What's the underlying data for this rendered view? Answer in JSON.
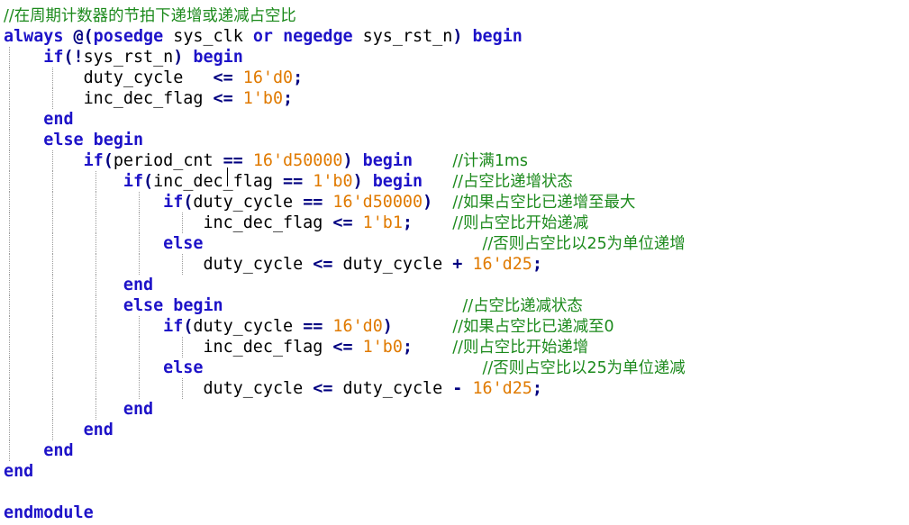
{
  "editor": {
    "language": "Verilog",
    "colors": {
      "keyword": "#1d12c8",
      "identifier": "#000000",
      "number": "#e07a00",
      "operator": "#000080",
      "comment": "#1c8a1c",
      "indent_guide": "#9a9a9a",
      "background": "#ffffff"
    },
    "lines": [
      [
        {
          "t": "cm",
          "v": "//在周期计数器的节拍下递增或递减占空比"
        }
      ],
      [
        {
          "t": "kw",
          "v": "always"
        },
        {
          "t": "id",
          "v": " "
        },
        {
          "t": "op",
          "v": "@("
        },
        {
          "t": "kw",
          "v": "posedge"
        },
        {
          "t": "id",
          "v": " sys_clk "
        },
        {
          "t": "kw",
          "v": "or"
        },
        {
          "t": "id",
          "v": " "
        },
        {
          "t": "kw",
          "v": "negedge"
        },
        {
          "t": "id",
          "v": " sys_rst_n"
        },
        {
          "t": "op",
          "v": ")"
        },
        {
          "t": "id",
          "v": " "
        },
        {
          "t": "kw",
          "v": "begin"
        }
      ],
      [
        {
          "t": "id",
          "v": "    "
        },
        {
          "t": "kw",
          "v": "if"
        },
        {
          "t": "op",
          "v": "(!"
        },
        {
          "t": "id",
          "v": "sys_rst_n"
        },
        {
          "t": "op",
          "v": ")"
        },
        {
          "t": "id",
          "v": " "
        },
        {
          "t": "kw",
          "v": "begin"
        }
      ],
      [
        {
          "t": "id",
          "v": "        duty_cycle   "
        },
        {
          "t": "op",
          "v": "<="
        },
        {
          "t": "id",
          "v": " "
        },
        {
          "t": "num",
          "v": "16'd0"
        },
        {
          "t": "op",
          "v": ";"
        }
      ],
      [
        {
          "t": "id",
          "v": "        inc_dec_flag "
        },
        {
          "t": "op",
          "v": "<="
        },
        {
          "t": "id",
          "v": " "
        },
        {
          "t": "num",
          "v": "1'b0"
        },
        {
          "t": "op",
          "v": ";"
        }
      ],
      [
        {
          "t": "id",
          "v": "    "
        },
        {
          "t": "kw",
          "v": "end"
        }
      ],
      [
        {
          "t": "id",
          "v": "    "
        },
        {
          "t": "kw",
          "v": "else"
        },
        {
          "t": "id",
          "v": " "
        },
        {
          "t": "kw",
          "v": "begin"
        }
      ],
      [
        {
          "t": "id",
          "v": "        "
        },
        {
          "t": "kw",
          "v": "if"
        },
        {
          "t": "op",
          "v": "("
        },
        {
          "t": "id",
          "v": "period_cnt "
        },
        {
          "t": "op",
          "v": "=="
        },
        {
          "t": "id",
          "v": " "
        },
        {
          "t": "num",
          "v": "16'd50000"
        },
        {
          "t": "op",
          "v": ")"
        },
        {
          "t": "id",
          "v": " "
        },
        {
          "t": "kw",
          "v": "begin"
        },
        {
          "t": "id",
          "v": "    "
        },
        {
          "t": "cm",
          "v": "//计满1ms"
        }
      ],
      [
        {
          "t": "id",
          "v": "            "
        },
        {
          "t": "kw",
          "v": "if"
        },
        {
          "t": "op",
          "v": "("
        },
        {
          "t": "id",
          "v": "inc_dec_flag "
        },
        {
          "t": "op",
          "v": "=="
        },
        {
          "t": "id",
          "v": " "
        },
        {
          "t": "num",
          "v": "1'b0"
        },
        {
          "t": "op",
          "v": ")"
        },
        {
          "t": "id",
          "v": " "
        },
        {
          "t": "kw",
          "v": "begin"
        },
        {
          "t": "id",
          "v": "   "
        },
        {
          "t": "cm",
          "v": "//占空比递增状态"
        }
      ],
      [
        {
          "t": "id",
          "v": "                "
        },
        {
          "t": "kw",
          "v": "if"
        },
        {
          "t": "op",
          "v": "("
        },
        {
          "t": "id",
          "v": "duty_cycle "
        },
        {
          "t": "op",
          "v": "=="
        },
        {
          "t": "id",
          "v": " "
        },
        {
          "t": "num",
          "v": "16'd50000"
        },
        {
          "t": "op",
          "v": ")"
        },
        {
          "t": "id",
          "v": "  "
        },
        {
          "t": "cm",
          "v": "//如果占空比已递增至最大"
        }
      ],
      [
        {
          "t": "id",
          "v": "                    inc_dec_flag "
        },
        {
          "t": "op",
          "v": "<="
        },
        {
          "t": "id",
          "v": " "
        },
        {
          "t": "num",
          "v": "1'b1"
        },
        {
          "t": "op",
          "v": ";"
        },
        {
          "t": "id",
          "v": "    "
        },
        {
          "t": "cm",
          "v": "//则占空比开始递减"
        }
      ],
      [
        {
          "t": "id",
          "v": "                "
        },
        {
          "t": "kw",
          "v": "else"
        },
        {
          "t": "id",
          "v": "                            "
        },
        {
          "t": "cm",
          "v": "//否则占空比以25为单位递增"
        }
      ],
      [
        {
          "t": "id",
          "v": "                    duty_cycle "
        },
        {
          "t": "op",
          "v": "<="
        },
        {
          "t": "id",
          "v": " duty_cycle "
        },
        {
          "t": "op",
          "v": "+"
        },
        {
          "t": "id",
          "v": " "
        },
        {
          "t": "num",
          "v": "16'd25"
        },
        {
          "t": "op",
          "v": ";"
        }
      ],
      [
        {
          "t": "id",
          "v": "            "
        },
        {
          "t": "kw",
          "v": "end"
        }
      ],
      [
        {
          "t": "id",
          "v": "            "
        },
        {
          "t": "kw",
          "v": "else"
        },
        {
          "t": "id",
          "v": " "
        },
        {
          "t": "kw",
          "v": "begin"
        },
        {
          "t": "id",
          "v": "                        "
        },
        {
          "t": "cm",
          "v": "//占空比递减状态"
        }
      ],
      [
        {
          "t": "id",
          "v": "                "
        },
        {
          "t": "kw",
          "v": "if"
        },
        {
          "t": "op",
          "v": "("
        },
        {
          "t": "id",
          "v": "duty_cycle "
        },
        {
          "t": "op",
          "v": "=="
        },
        {
          "t": "id",
          "v": " "
        },
        {
          "t": "num",
          "v": "16'd0"
        },
        {
          "t": "op",
          "v": ")"
        },
        {
          "t": "id",
          "v": "      "
        },
        {
          "t": "cm",
          "v": "//如果占空比已递减至0"
        }
      ],
      [
        {
          "t": "id",
          "v": "                    inc_dec_flag "
        },
        {
          "t": "op",
          "v": "<="
        },
        {
          "t": "id",
          "v": " "
        },
        {
          "t": "num",
          "v": "1'b0"
        },
        {
          "t": "op",
          "v": ";"
        },
        {
          "t": "id",
          "v": "    "
        },
        {
          "t": "cm",
          "v": "//则占空比开始递增"
        }
      ],
      [
        {
          "t": "id",
          "v": "                "
        },
        {
          "t": "kw",
          "v": "else"
        },
        {
          "t": "id",
          "v": "                            "
        },
        {
          "t": "cm",
          "v": "//否则占空比以25为单位递减"
        }
      ],
      [
        {
          "t": "id",
          "v": "                    duty_cycle "
        },
        {
          "t": "op",
          "v": "<="
        },
        {
          "t": "id",
          "v": " duty_cycle "
        },
        {
          "t": "op",
          "v": "-"
        },
        {
          "t": "id",
          "v": " "
        },
        {
          "t": "num",
          "v": "16'd25"
        },
        {
          "t": "op",
          "v": ";"
        }
      ],
      [
        {
          "t": "id",
          "v": "            "
        },
        {
          "t": "kw",
          "v": "end"
        }
      ],
      [
        {
          "t": "id",
          "v": "        "
        },
        {
          "t": "kw",
          "v": "end"
        }
      ],
      [
        {
          "t": "id",
          "v": "    "
        },
        {
          "t": "kw",
          "v": "end"
        }
      ],
      [
        {
          "t": "kw",
          "v": "end"
        }
      ],
      [],
      [
        {
          "t": "kw",
          "v": "endmodule"
        }
      ]
    ]
  }
}
